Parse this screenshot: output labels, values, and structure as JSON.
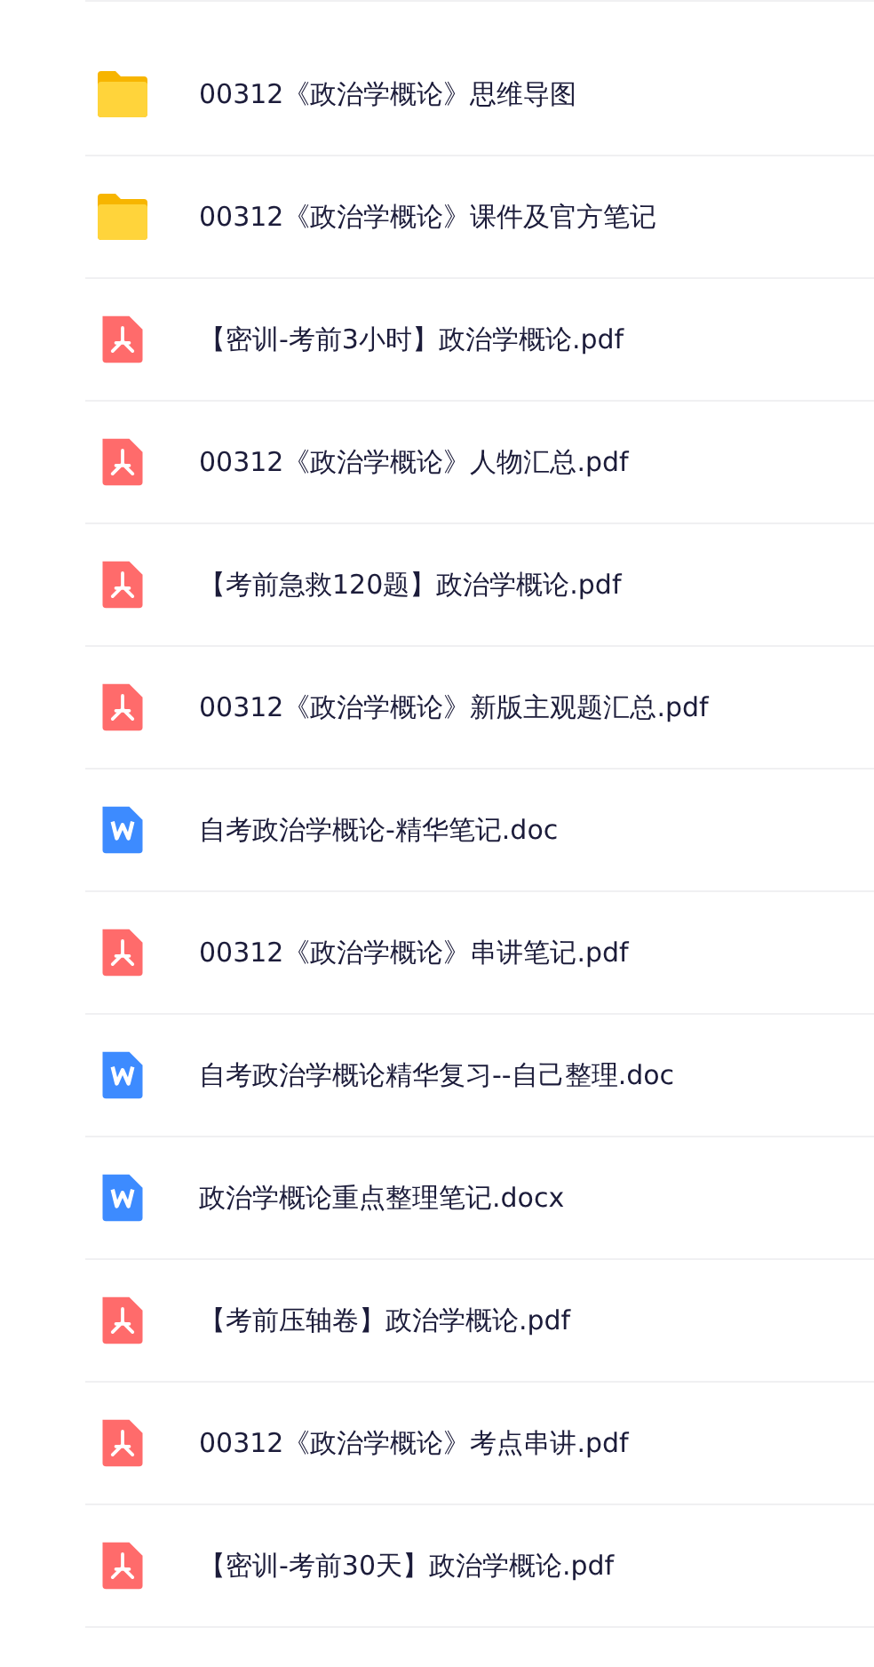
{
  "files": [
    {
      "kind": "folder",
      "name": "00312《政治学概论》思维导图"
    },
    {
      "kind": "folder",
      "name": "00312《政治学概论》课件及官方笔记"
    },
    {
      "kind": "pdf",
      "name": "【密训-考前3小时】政治学概论.pdf"
    },
    {
      "kind": "pdf",
      "name": "00312《政治学概论》人物汇总.pdf"
    },
    {
      "kind": "pdf",
      "name": "【考前急救120题】政治学概论.pdf"
    },
    {
      "kind": "pdf",
      "name": "00312《政治学概论》新版主观题汇总.pdf"
    },
    {
      "kind": "doc",
      "name": "自考政治学概论-精华笔记.doc"
    },
    {
      "kind": "pdf",
      "name": "00312《政治学概论》串讲笔记.pdf"
    },
    {
      "kind": "doc",
      "name": "自考政治学概论精华复习--自己整理.doc"
    },
    {
      "kind": "doc",
      "name": "政治学概论重点整理笔记.docx"
    },
    {
      "kind": "pdf",
      "name": "【考前压轴卷】政治学概论.pdf"
    },
    {
      "kind": "pdf",
      "name": "00312《政治学概论》考点串讲.pdf"
    },
    {
      "kind": "pdf",
      "name": "【密训-考前30天】政治学概论.pdf"
    }
  ]
}
